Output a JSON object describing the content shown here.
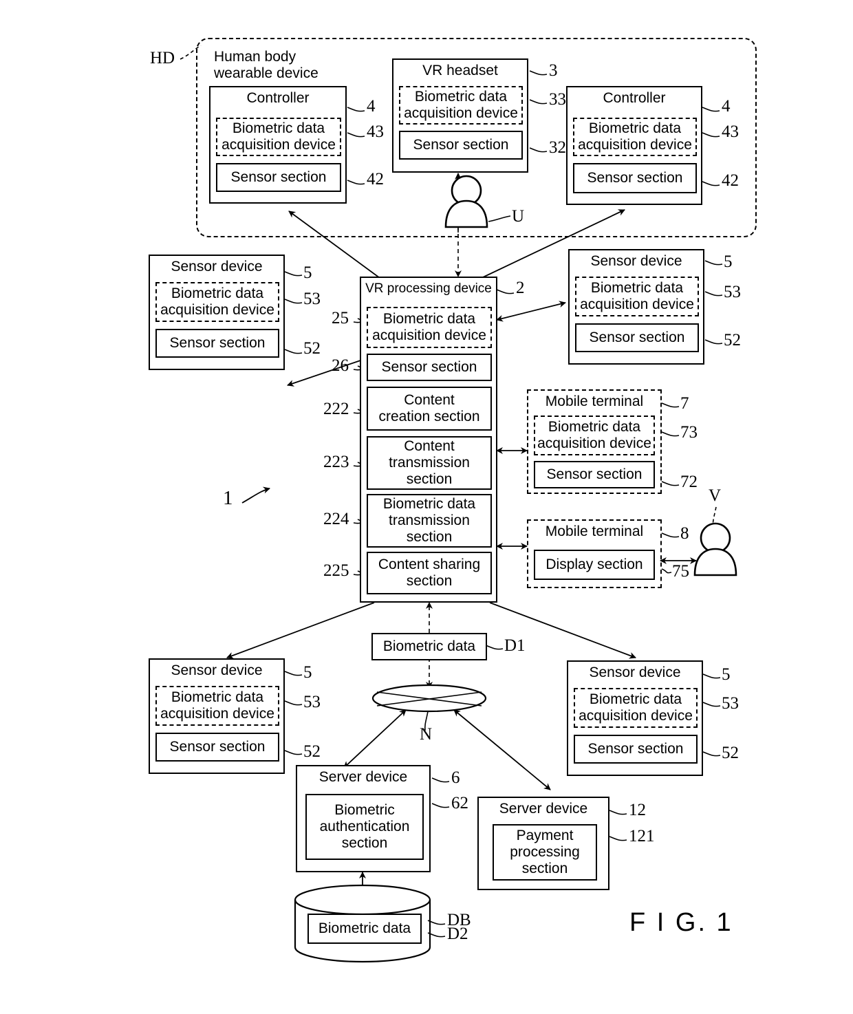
{
  "figure": {
    "label": "F I G. 1",
    "system_ref": "1"
  },
  "hd_group": {
    "tag": "HD",
    "title": "Human body\nwearable device"
  },
  "controller_left": {
    "title": "Controller",
    "ref": "4",
    "biometric": {
      "label": "Biometric data\nacquisition device",
      "ref": "43"
    },
    "sensor": {
      "label": "Sensor section",
      "ref": "42"
    }
  },
  "vr_headset": {
    "title": "VR headset",
    "ref": "3",
    "biometric": {
      "label": "Biometric data\nacquisition device",
      "ref": "33"
    },
    "sensor": {
      "label": "Sensor section",
      "ref": "32"
    }
  },
  "controller_right": {
    "title": "Controller",
    "ref": "4",
    "biometric": {
      "label": "Biometric data\nacquisition device",
      "ref": "43"
    },
    "sensor": {
      "label": "Sensor section",
      "ref": "42"
    }
  },
  "user_u": {
    "tag": "U"
  },
  "user_v": {
    "tag": "V"
  },
  "sensor_device_top_left": {
    "title": "Sensor device",
    "ref": "5",
    "biometric": {
      "label": "Biometric data\nacquisition device",
      "ref": "53"
    },
    "sensor": {
      "label": "Sensor section",
      "ref": "52"
    }
  },
  "sensor_device_top_right": {
    "title": "Sensor device",
    "ref": "5",
    "biometric": {
      "label": "Biometric data\nacquisition device",
      "ref": "53"
    },
    "sensor": {
      "label": "Sensor section",
      "ref": "52"
    }
  },
  "sensor_device_bottom_left": {
    "title": "Sensor device",
    "ref": "5",
    "biometric": {
      "label": "Biometric data\nacquisition device",
      "ref": "53"
    },
    "sensor": {
      "label": "Sensor section",
      "ref": "52"
    }
  },
  "sensor_device_bottom_right": {
    "title": "Sensor device",
    "ref": "5",
    "biometric": {
      "label": "Biometric data\nacquisition device",
      "ref": "53"
    },
    "sensor": {
      "label": "Sensor section",
      "ref": "52"
    }
  },
  "vr_processing_device": {
    "title": "VR processing device",
    "ref": "2",
    "sections": [
      {
        "label": "Biometric data\nacquisition device",
        "ref": "25",
        "style": "dashed"
      },
      {
        "label": "Sensor section",
        "ref": "26",
        "style": "solid"
      },
      {
        "label": "Content\ncreation section",
        "ref": "222",
        "style": "solid"
      },
      {
        "label": "Content\ntransmission\nsection",
        "ref": "223",
        "style": "solid"
      },
      {
        "label": "Biometric data\ntransmission\nsection",
        "ref": "224",
        "style": "solid"
      },
      {
        "label": "Content sharing\nsection",
        "ref": "225",
        "style": "solid"
      }
    ]
  },
  "mobile_terminal_7": {
    "title": "Mobile terminal",
    "ref": "7",
    "biometric": {
      "label": "Biometric data\nacquisition device",
      "ref": "73"
    },
    "sensor": {
      "label": "Sensor section",
      "ref": "72"
    }
  },
  "mobile_terminal_8": {
    "title": "Mobile terminal",
    "ref": "8",
    "display": {
      "label": "Display section",
      "ref": "75"
    }
  },
  "biometric_data_d1": {
    "label": "Biometric data",
    "ref": "D1"
  },
  "network": {
    "tag": "N"
  },
  "server_device_6": {
    "title": "Server device",
    "ref": "6",
    "section": {
      "label": "Biometric\nauthentication\nsection",
      "ref": "62"
    }
  },
  "server_device_12": {
    "title": "Server device",
    "ref": "12",
    "section": {
      "label": "Payment\nprocessing\nsection",
      "ref": "121"
    }
  },
  "database": {
    "ref": "DB",
    "record": {
      "label": "Biometric data",
      "ref": "D2"
    }
  }
}
